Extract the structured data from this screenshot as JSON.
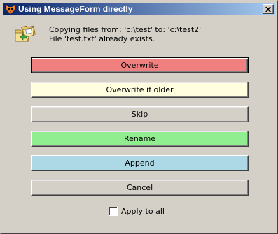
{
  "window": {
    "title": "Using MessageForm directly",
    "app_icon": "cat-head-icon",
    "close_icon": "close-icon"
  },
  "message": {
    "icon": "folders-copy-icon",
    "line1": "Copying files from: 'c:\\test' to: 'c:\\test2'",
    "line2": "File 'test.txt' already exists."
  },
  "buttons": [
    {
      "label": "Overwrite",
      "color": "#f08080"
    },
    {
      "label": "Overwrite if older",
      "color": "#ffffe0"
    },
    {
      "label": "Skip",
      "color": "#d4d0c8"
    },
    {
      "label": "Rename",
      "color": "#90ee90"
    },
    {
      "label": "Append",
      "color": "#add8e6"
    },
    {
      "label": "Cancel",
      "color": "#d4d0c8"
    }
  ],
  "apply_to_all": {
    "label": "Apply to all",
    "checked": false
  }
}
